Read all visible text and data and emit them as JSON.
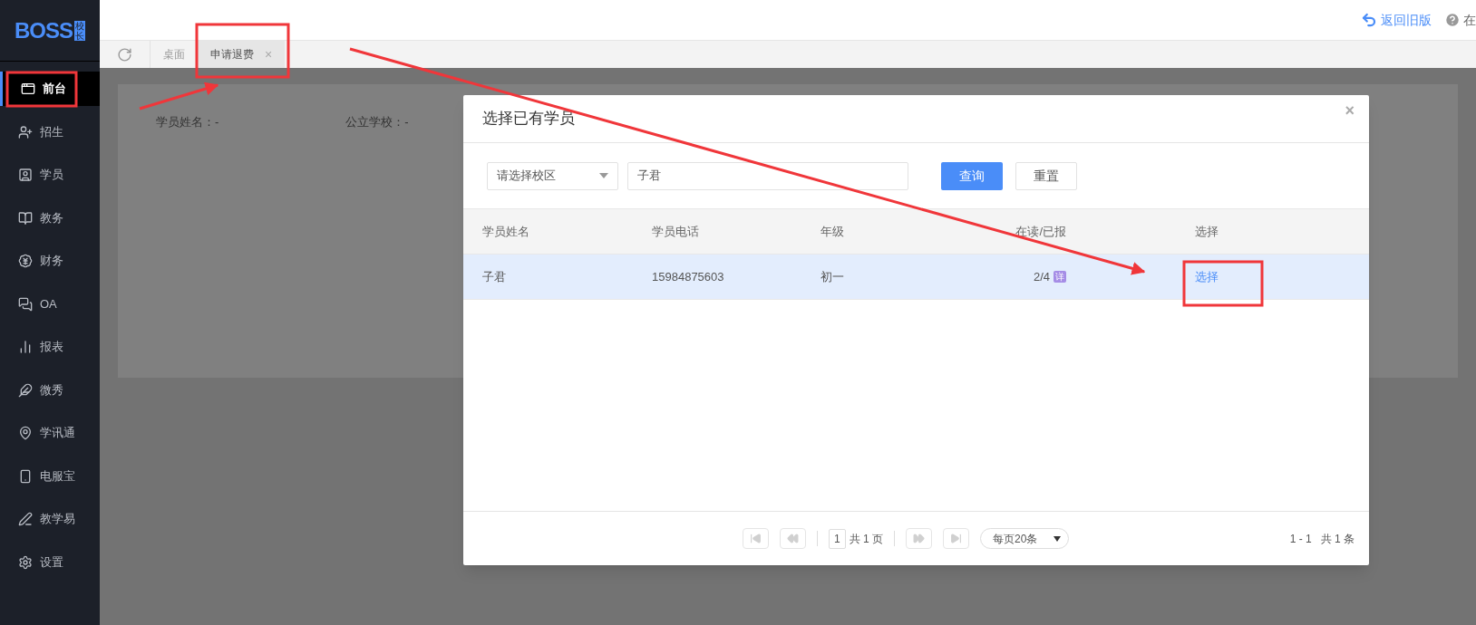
{
  "sidebar": {
    "logo": {
      "text": "BOSS",
      "badge": "校长"
    },
    "items": [
      {
        "label": "前台",
        "selected": true
      },
      {
        "label": "招生",
        "selected": false
      },
      {
        "label": "学员",
        "selected": false
      },
      {
        "label": "教务",
        "selected": false
      },
      {
        "label": "财务",
        "selected": false
      },
      {
        "label": "OA",
        "selected": false
      },
      {
        "label": "报表",
        "selected": false
      },
      {
        "label": "微秀",
        "selected": false
      },
      {
        "label": "学讯通",
        "selected": false
      },
      {
        "label": "电服宝",
        "selected": false
      },
      {
        "label": "教学易",
        "selected": false
      },
      {
        "label": "设置",
        "selected": false
      }
    ]
  },
  "topbar": {
    "back_link": "返回旧版",
    "help_text": "在"
  },
  "tabs": [
    {
      "label": "桌面",
      "selected": false
    },
    {
      "label": "申请退费",
      "selected": true,
      "close": "×"
    }
  ],
  "background_fields": [
    {
      "label": "学员姓名：",
      "value": "-"
    },
    {
      "label": "公立学校：",
      "value": "-"
    }
  ],
  "modal": {
    "title": "选择已有学员",
    "close": "×",
    "campus_select": {
      "placeholder": "请选择校区"
    },
    "search": {
      "value": "子君"
    },
    "buttons": [
      {
        "label": "查询",
        "kind": "primary"
      },
      {
        "label": "重置",
        "kind": "default"
      }
    ],
    "table": {
      "columns": [
        "学员姓名",
        "学员电话",
        "年级",
        "在读/已报",
        "选择"
      ],
      "rows": [
        {
          "name": "子君",
          "phone": "15984875603",
          "grade": "初一",
          "progress": "2/4",
          "detail": "详",
          "action": "选择",
          "selected": true
        }
      ]
    },
    "pagination": {
      "nav_disabled": true,
      "page": "1",
      "total_pages": "共 1 页",
      "page_size": "每页20条",
      "summary": "1 - 1   共 1 条"
    }
  }
}
